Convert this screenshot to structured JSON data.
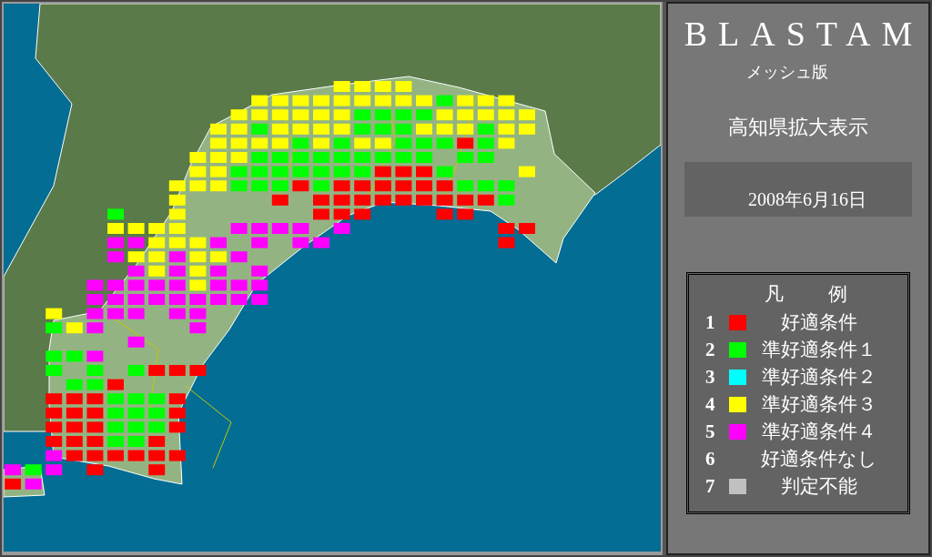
{
  "panel": {
    "title": "BLASTAM",
    "subtitle": "メッシュ版",
    "region": "高知県拡大表示",
    "date": "2008年6月16日"
  },
  "legend": {
    "title": "凡　例",
    "items": [
      {
        "number": "1",
        "label": "好適条件",
        "color": "#ff0000"
      },
      {
        "number": "2",
        "label": "準好適条件１",
        "color": "#00ff00"
      },
      {
        "number": "3",
        "label": "準好適条件２",
        "color": "#00ffff"
      },
      {
        "number": "4",
        "label": "準好適条件３",
        "color": "#ffff00"
      },
      {
        "number": "5",
        "label": "準好適条件４",
        "color": "#ff00ff"
      },
      {
        "number": "6",
        "label": "好適条件なし"
      },
      {
        "number": "7",
        "label": "判定不能",
        "color": "#c0c0c0"
      }
    ]
  }
}
